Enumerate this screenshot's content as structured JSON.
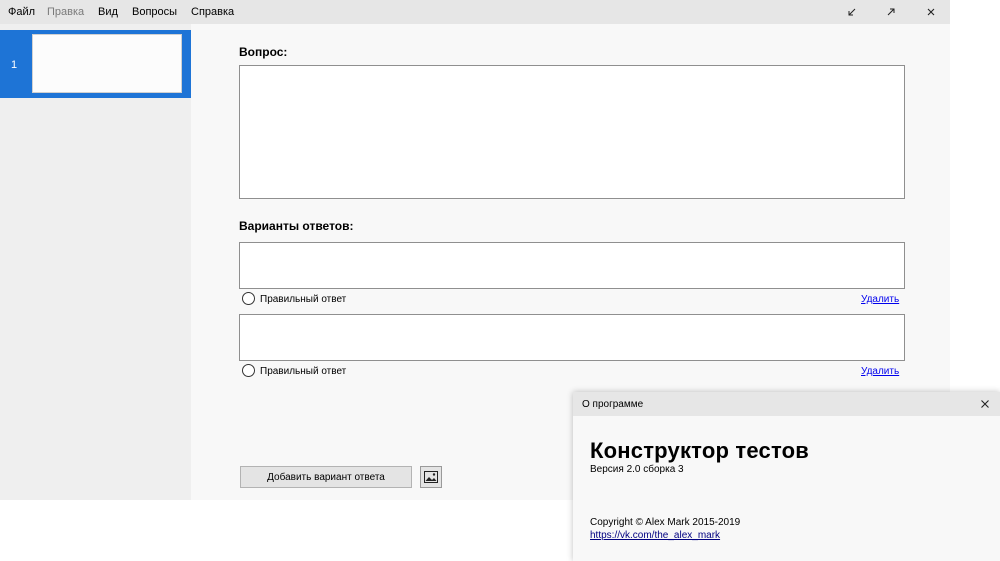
{
  "menu": {
    "file": "Файл",
    "edit": "Правка",
    "view": "Вид",
    "questions": "Вопросы",
    "help": "Справка"
  },
  "window_controls": [
    "minimize-icon",
    "maximize-icon",
    "close-icon"
  ],
  "sidebar": {
    "slides": [
      {
        "number": "1",
        "selected": true
      }
    ]
  },
  "editor": {
    "question_label": "Вопрос:",
    "question_text": "",
    "answers_label": "Варианты ответов:",
    "answers": [
      {
        "text": "",
        "correct_label": "Правильный ответ",
        "delete_label": "Удалить",
        "correct": false
      },
      {
        "text": "",
        "correct_label": "Правильный ответ",
        "delete_label": "Удалить",
        "correct": false
      }
    ],
    "add_answer_label": "Добавить вариант ответа",
    "image_button_icon": "image-icon"
  },
  "about_dialog": {
    "title": "О программе",
    "app_name": "Конструктор тестов",
    "version": "Версия 2.0 сборка 3",
    "copyright": "Copyright © Alex Mark 2015-2019",
    "link": "https://vk.com/the_alex_mark"
  },
  "colors": {
    "accent": "#1e74d6",
    "menubar": "#e6e6e6",
    "background": "#f8f8f8",
    "link": "#0000ee"
  }
}
